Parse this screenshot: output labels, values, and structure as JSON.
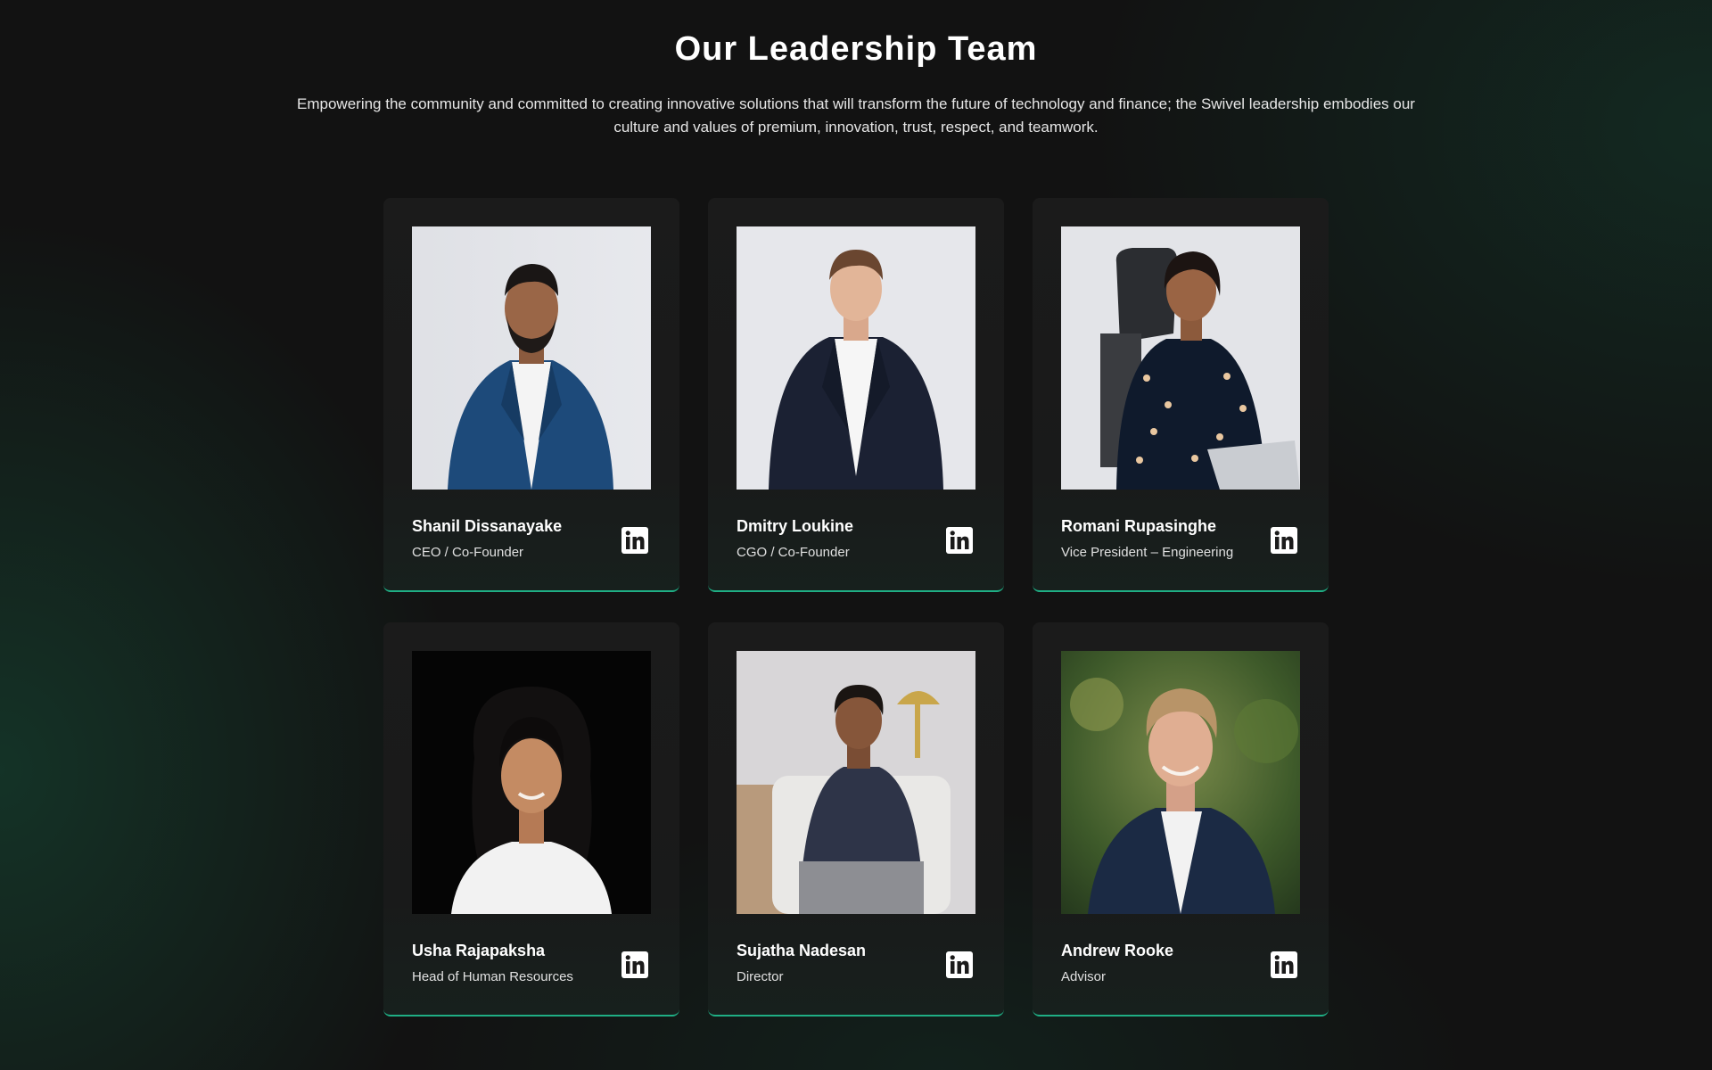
{
  "section": {
    "title": "Our Leadership Team",
    "intro": "Empowering the community and committed to creating innovative solutions that will transform the future of technology and finance; the Swivel leadership embodies our culture and values of premium, innovation, trust, respect, and teamwork."
  },
  "theme": {
    "background": "#121212",
    "card_background": "#1b1b1b",
    "accent": "#1fae84",
    "text": "#ffffff"
  },
  "members": [
    {
      "name": "Shanil Dissanayake",
      "role": "CEO / Co-Founder",
      "icon": "linkedin-icon"
    },
    {
      "name": "Dmitry Loukine",
      "role": "CGO / Co-Founder",
      "icon": "linkedin-icon"
    },
    {
      "name": "Romani Rupasinghe",
      "role": "Vice President – Engineering",
      "icon": "linkedin-icon"
    },
    {
      "name": "Usha Rajapaksha",
      "role": "Head of Human Resources",
      "icon": "linkedin-icon"
    },
    {
      "name": "Sujatha Nadesan",
      "role": "Director",
      "icon": "linkedin-icon"
    },
    {
      "name": "Andrew Rooke",
      "role": "Advisor",
      "icon": "linkedin-icon"
    }
  ]
}
